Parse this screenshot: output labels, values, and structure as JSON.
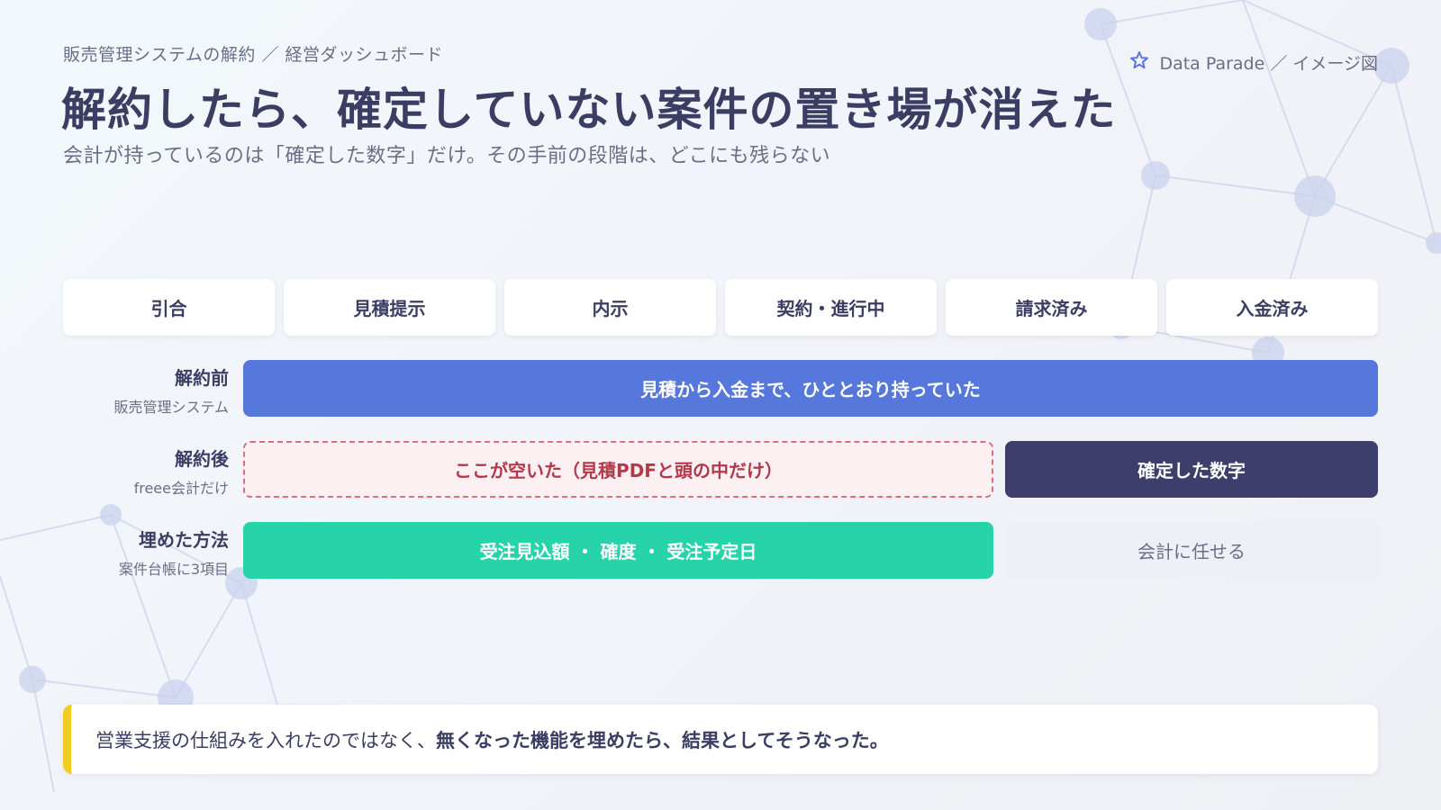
{
  "header": {
    "breadcrumb": "販売管理システムの解約 ／ 経営ダッシュボード",
    "brand": "Data Parade ／ イメージ図",
    "title": "解約したら、確定していない案件の置き場が消えた",
    "subtitle": "会計が持っているのは「確定した数字」だけ。その手前の段階は、どこにも残らない"
  },
  "stages": [
    "引合",
    "見積提示",
    "内示",
    "契約・進行中",
    "請求済み",
    "入金済み"
  ],
  "rows": {
    "before": {
      "label": "解約前",
      "sublabel": "販売管理システム",
      "bar": "見積から入金まで、ひととおり持っていた"
    },
    "after": {
      "label": "解約後",
      "sublabel": "freee会計だけ",
      "gap_bar": "ここが空いた（見積PDFと頭の中だけ）",
      "fixed_bar": "確定した数字"
    },
    "method": {
      "label": "埋めた方法",
      "sublabel": "案件台帳に3項目",
      "fill_bar": "受注見込額 ・ 確度 ・ 受注予定日",
      "accounting_bar": "会計に任せる"
    }
  },
  "conclusion": {
    "normal": "営業支援の仕組みを入れたのではなく、",
    "bold": "無くなった機能を埋めたら、結果としてそうなった。"
  },
  "colors": {
    "before_bar": "#5677db",
    "gap_bar_border": "#d9707c",
    "fixed_bar": "#3d3e6b",
    "fill_bar": "#27d3a8",
    "accent_line": "#f2cc22"
  },
  "icons": {
    "brand": "star-outline-icon"
  }
}
